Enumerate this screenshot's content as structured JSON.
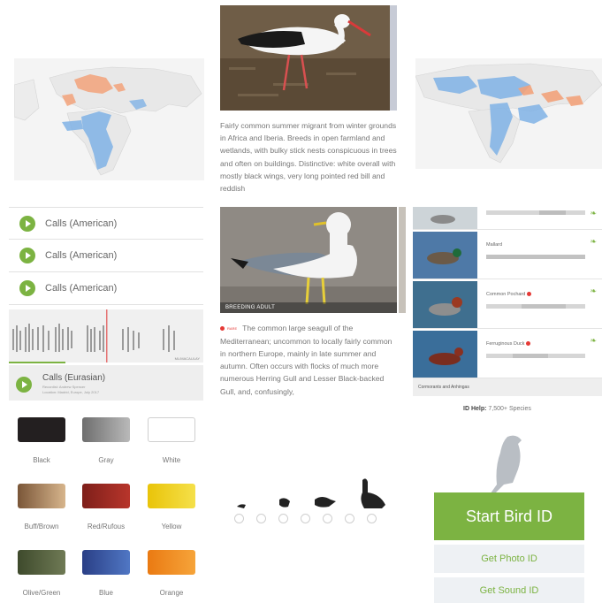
{
  "audio": {
    "calls": [
      "Calls (American)",
      "Calls (American)",
      "Calls (American)"
    ],
    "eurasian": {
      "title": "Calls (Eurasian)",
      "recordist": "Recordist: Andrew Spencer",
      "location": "Location: Madrid, Europe, July 2017"
    },
    "spectrogram_credit": "ML/MACAULAY",
    "progress_fraction": 0.29
  },
  "colors": [
    {
      "label": "Black",
      "swatch": "#231f20"
    },
    {
      "label": "Gray",
      "swatch": "#8a8a8a"
    },
    {
      "label": "White",
      "swatch": "#ffffff"
    },
    {
      "label": "Buff/Brown",
      "swatch": "#a9825b"
    },
    {
      "label": "Red/Rufous",
      "swatch": "#9e2a22"
    },
    {
      "label": "Yellow",
      "swatch": "#f0d20a"
    },
    {
      "label": "Olive/Green",
      "swatch": "#4f5a39"
    },
    {
      "label": "Blue",
      "swatch": "#3453a0"
    },
    {
      "label": "Orange",
      "swatch": "#f08a1b"
    }
  ],
  "stork": {
    "description": "Fairly common summer migrant from winter grounds in Africa and Iberia. Breeds in open farmland and wetlands, with bulky stick nests conspicuous in trees and often on buildings. Distinctive: white overall with mostly black wings, very long pointed red bill and reddish"
  },
  "gull": {
    "photo_label": "BREEDING ADULT",
    "rare_tag": "RARE",
    "description": "The common large seagull of the Mediterranean; uncommon to locally fairly common in northern Europe, mainly in late summer and autumn. Often occurs with flocks of much more numerous Herring Gull and Lesser Black-backed Gull, and, confusingly,"
  },
  "species_list": [
    {
      "name": "",
      "rare": false
    },
    {
      "name": "Mallard",
      "rare": false
    },
    {
      "name": "Common Pochard",
      "rare": true
    },
    {
      "name": "Ferruginous Duck",
      "rare": true
    }
  ],
  "section_header": "Cormorants and Anhingas",
  "id_help": {
    "label": "ID Help:",
    "value": "7,500+ Species"
  },
  "buttons": {
    "start": "Start Bird ID",
    "photo": "Get Photo ID",
    "sound": "Get Sound ID"
  },
  "theme": {
    "accent_green": "#7cb342",
    "range_blue": "#7fb2e5",
    "range_orange": "#f2a27a",
    "rare_red": "#e53935"
  }
}
